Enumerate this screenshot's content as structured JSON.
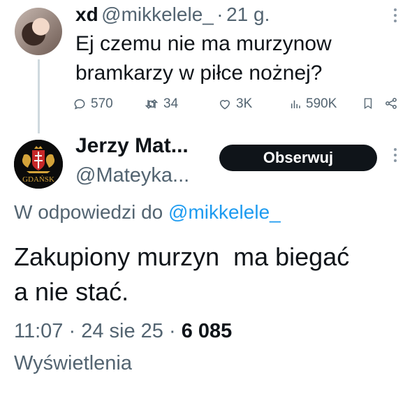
{
  "tweet1": {
    "name": "xd",
    "handle": "@mikkelele_",
    "separator": "·",
    "time": "21 g.",
    "text_line1": "Ej czemu nie ma murzynow",
    "text_line2": "bramkarzy w piłce nożnej?",
    "stats": {
      "replies": "570",
      "retweets": "34",
      "likes": "3K",
      "views": "590K"
    }
  },
  "tweet2": {
    "name": "Jerzy Mat...",
    "handle": "@Mateyka...",
    "follow_label": "Obserwuj",
    "avatar_text": "GDAŃSK",
    "reply_prefix": "W odpowiedzi do",
    "reply_mention": "@mikkelele_",
    "text_line1": "Zakupiony murzyn  ma biegać",
    "text_line2": "a nie stać.",
    "time": "11:07",
    "sep1": "·",
    "date": "24 sie 25",
    "sep2": "·",
    "views_count": "6 085",
    "views_label": "Wyświetlenia"
  },
  "colors": {
    "text": "#0f1419",
    "secondary": "#536471",
    "link": "#1d9bf0",
    "button_bg": "#0f1419",
    "thread_line": "#cfd9de"
  }
}
